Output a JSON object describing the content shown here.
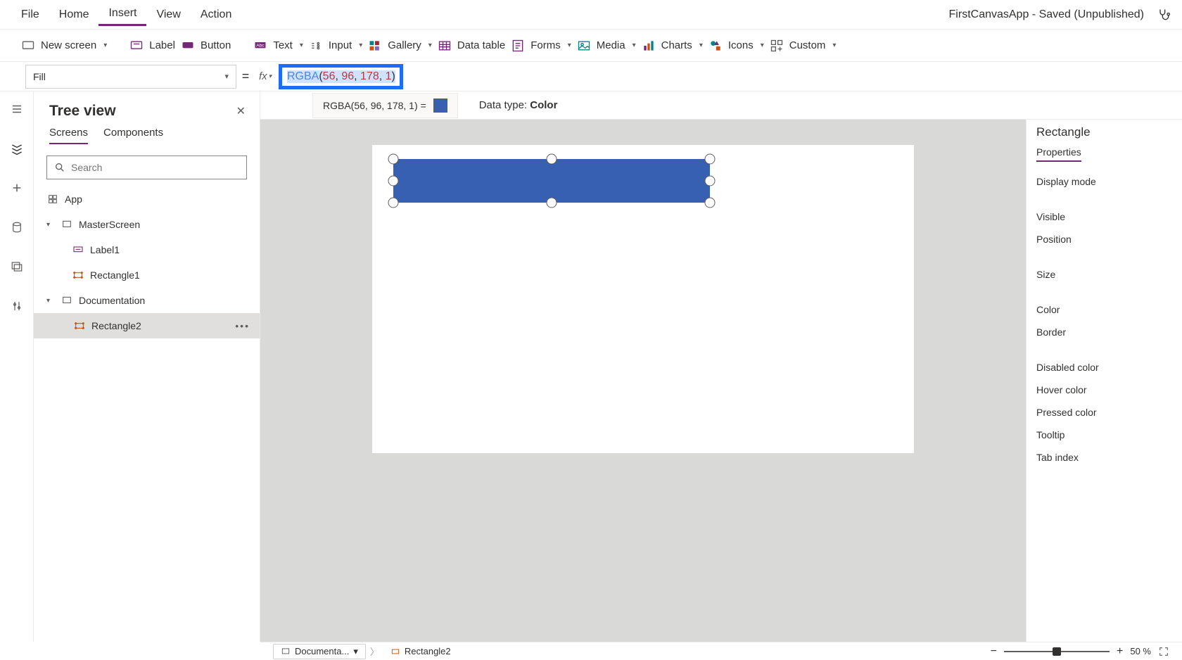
{
  "menubar": {
    "items": [
      "File",
      "Home",
      "Insert",
      "View",
      "Action"
    ],
    "active_index": 2,
    "app_title": "FirstCanvasApp - Saved (Unpublished)"
  },
  "ribbon": {
    "new_screen": "New screen",
    "label": "Label",
    "button": "Button",
    "text": "Text",
    "input": "Input",
    "gallery": "Gallery",
    "data_table": "Data table",
    "forms": "Forms",
    "media": "Media",
    "charts": "Charts",
    "icons": "Icons",
    "custom": "Custom"
  },
  "formula": {
    "property": "Fill",
    "fn": "RGBA",
    "args": [
      "56",
      "96",
      "178",
      "1"
    ],
    "result_text": "RGBA(56, 96, 178, 1)  =",
    "swatch_color": "#3860B2",
    "datatype_label": "Data type: ",
    "datatype_value": "Color"
  },
  "treeview": {
    "title": "Tree view",
    "tabs": [
      "Screens",
      "Components"
    ],
    "active_tab": 0,
    "search_placeholder": "Search",
    "nodes": {
      "app": "App",
      "master": "MasterScreen",
      "label1": "Label1",
      "rect1": "Rectangle1",
      "doc": "Documentation",
      "rect2": "Rectangle2"
    }
  },
  "canvas": {
    "shape_color": "#3860B2"
  },
  "properties": {
    "header": "Rectangle",
    "tab": "Properties",
    "items": [
      "Display mode",
      "Visible",
      "Position",
      "Size",
      "Color",
      "Border",
      "Disabled color",
      "Hover color",
      "Pressed color",
      "Tooltip",
      "Tab index"
    ]
  },
  "statusbar": {
    "crumb1": "Documenta...",
    "crumb2": "Rectangle2",
    "zoom_pct": "50  %"
  }
}
